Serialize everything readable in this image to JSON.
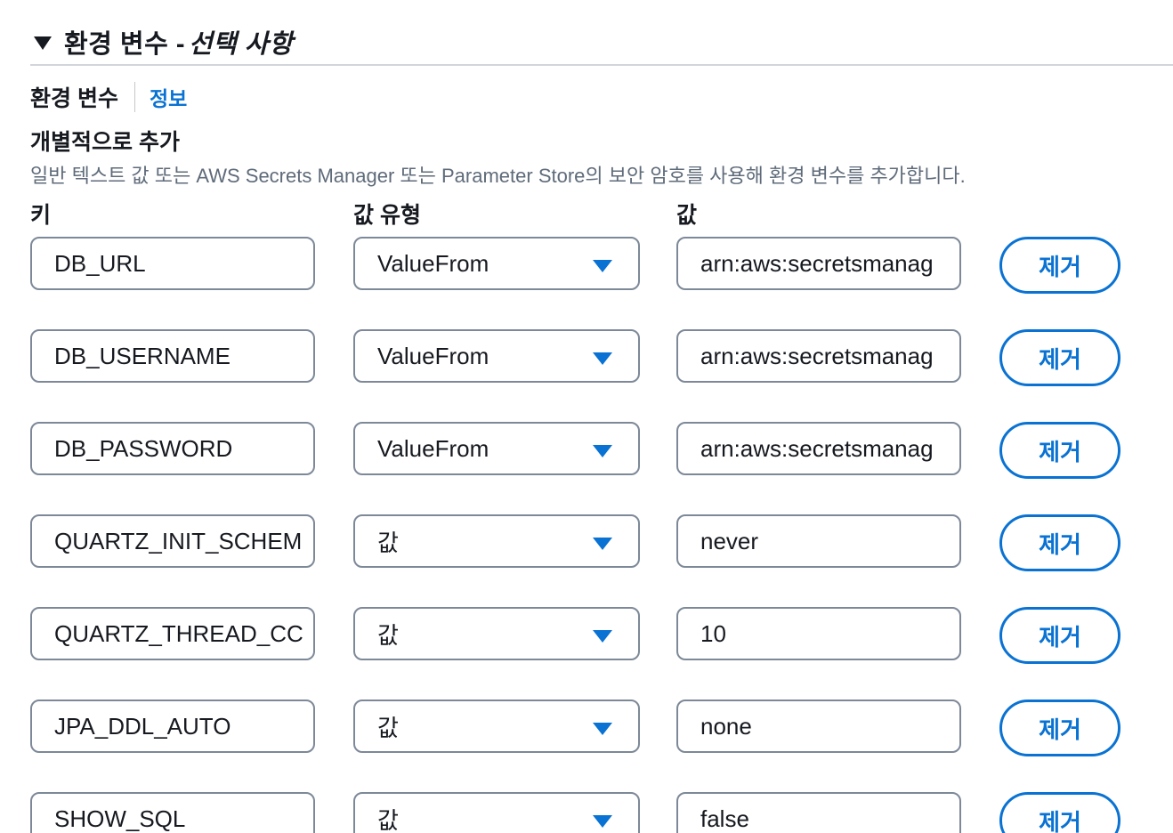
{
  "section": {
    "title": "환경 변수 -",
    "optional": "선택 사항"
  },
  "env": {
    "label": "환경 변수",
    "info_link": "정보",
    "subtitle": "개별적으로 추가",
    "description": "일반 텍스트 값 또는 AWS Secrets Manager 또는 Parameter Store의 보안 암호를 사용해 환경 변수를 추가합니다."
  },
  "columns": {
    "key": "키",
    "value_type": "값 유형",
    "value": "값"
  },
  "rows": [
    {
      "key": "DB_URL",
      "type": "ValueFrom",
      "value": "arn:aws:secretsmanag",
      "remove": "제거"
    },
    {
      "key": "DB_USERNAME",
      "type": "ValueFrom",
      "value": "arn:aws:secretsmanag",
      "remove": "제거"
    },
    {
      "key": "DB_PASSWORD",
      "type": "ValueFrom",
      "value": "arn:aws:secretsmanag",
      "remove": "제거"
    },
    {
      "key": "QUARTZ_INIT_SCHEM",
      "type": "값",
      "value": "never",
      "remove": "제거"
    },
    {
      "key": "QUARTZ_THREAD_CC",
      "type": "값",
      "value": "10",
      "remove": "제거"
    },
    {
      "key": "JPA_DDL_AUTO",
      "type": "값",
      "value": "none",
      "remove": "제거"
    },
    {
      "key": "SHOW_SQL",
      "type": "값",
      "value": "false",
      "remove": "제거"
    }
  ],
  "colors": {
    "accent": "#0972d3",
    "border": "#7d8998",
    "text": "#16191f",
    "muted": "#5f6b7a"
  }
}
